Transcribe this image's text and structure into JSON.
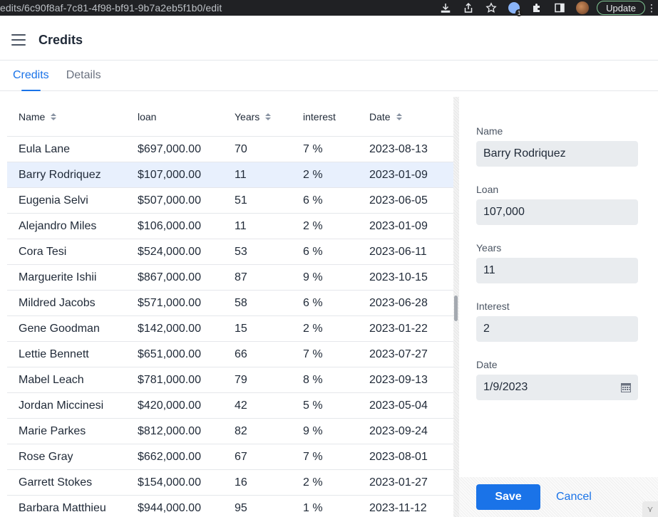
{
  "browser": {
    "url": "edits/6c90f8af-7c81-4f98-bf91-9b7a2eb5f1b0/edit",
    "update_label": "Update",
    "profile_badge": "1"
  },
  "header": {
    "title": "Credits"
  },
  "tabs": [
    {
      "label": "Credits",
      "active": true
    },
    {
      "label": "Details",
      "active": false
    }
  ],
  "grid": {
    "columns": [
      "Name",
      "loan",
      "Years",
      "interest",
      "Date"
    ],
    "sortable": [
      true,
      false,
      true,
      false,
      true
    ],
    "selected_index": 1,
    "rows": [
      {
        "name": "Eula Lane",
        "loan": "$697,000.00",
        "years": "70",
        "interest": "7 %",
        "date": "2023-08-13"
      },
      {
        "name": "Barry Rodriquez",
        "loan": "$107,000.00",
        "years": "11",
        "interest": "2 %",
        "date": "2023-01-09"
      },
      {
        "name": "Eugenia Selvi",
        "loan": "$507,000.00",
        "years": "51",
        "interest": "6 %",
        "date": "2023-06-05"
      },
      {
        "name": "Alejandro Miles",
        "loan": "$106,000.00",
        "years": "11",
        "interest": "2 %",
        "date": "2023-01-09"
      },
      {
        "name": "Cora Tesi",
        "loan": "$524,000.00",
        "years": "53",
        "interest": "6 %",
        "date": "2023-06-11"
      },
      {
        "name": "Marguerite Ishii",
        "loan": "$867,000.00",
        "years": "87",
        "interest": "9 %",
        "date": "2023-10-15"
      },
      {
        "name": "Mildred Jacobs",
        "loan": "$571,000.00",
        "years": "58",
        "interest": "6 %",
        "date": "2023-06-28"
      },
      {
        "name": "Gene Goodman",
        "loan": "$142,000.00",
        "years": "15",
        "interest": "2 %",
        "date": "2023-01-22"
      },
      {
        "name": "Lettie Bennett",
        "loan": "$651,000.00",
        "years": "66",
        "interest": "7 %",
        "date": "2023-07-27"
      },
      {
        "name": "Mabel Leach",
        "loan": "$781,000.00",
        "years": "79",
        "interest": "8 %",
        "date": "2023-09-13"
      },
      {
        "name": "Jordan Miccinesi",
        "loan": "$420,000.00",
        "years": "42",
        "interest": "5 %",
        "date": "2023-05-04"
      },
      {
        "name": "Marie Parkes",
        "loan": "$812,000.00",
        "years": "82",
        "interest": "9 %",
        "date": "2023-09-24"
      },
      {
        "name": "Rose Gray",
        "loan": "$662,000.00",
        "years": "67",
        "interest": "7 %",
        "date": "2023-08-01"
      },
      {
        "name": "Garrett Stokes",
        "loan": "$154,000.00",
        "years": "16",
        "interest": "2 %",
        "date": "2023-01-27"
      },
      {
        "name": "Barbara Matthieu",
        "loan": "$944,000.00",
        "years": "95",
        "interest": "1 %",
        "date": "2023-11-12"
      }
    ]
  },
  "editor": {
    "fields": [
      {
        "label": "Name",
        "value": "Barry Rodriquez"
      },
      {
        "label": "Loan",
        "value": "107,000"
      },
      {
        "label": "Years",
        "value": "11"
      },
      {
        "label": "Interest",
        "value": "2"
      },
      {
        "label": "Date",
        "value": "1/9/2023"
      }
    ],
    "save_label": "Save",
    "cancel_label": "Cancel"
  },
  "colors": {
    "accent": "#1a73e8",
    "selected_row": "#e8f0fd",
    "input_bg": "#e9ecef"
  },
  "icons": [
    "menu-icon",
    "download-icon",
    "share-icon",
    "star-icon",
    "extension-icon",
    "sidebar-icon",
    "sort-icon",
    "calendar-icon"
  ]
}
